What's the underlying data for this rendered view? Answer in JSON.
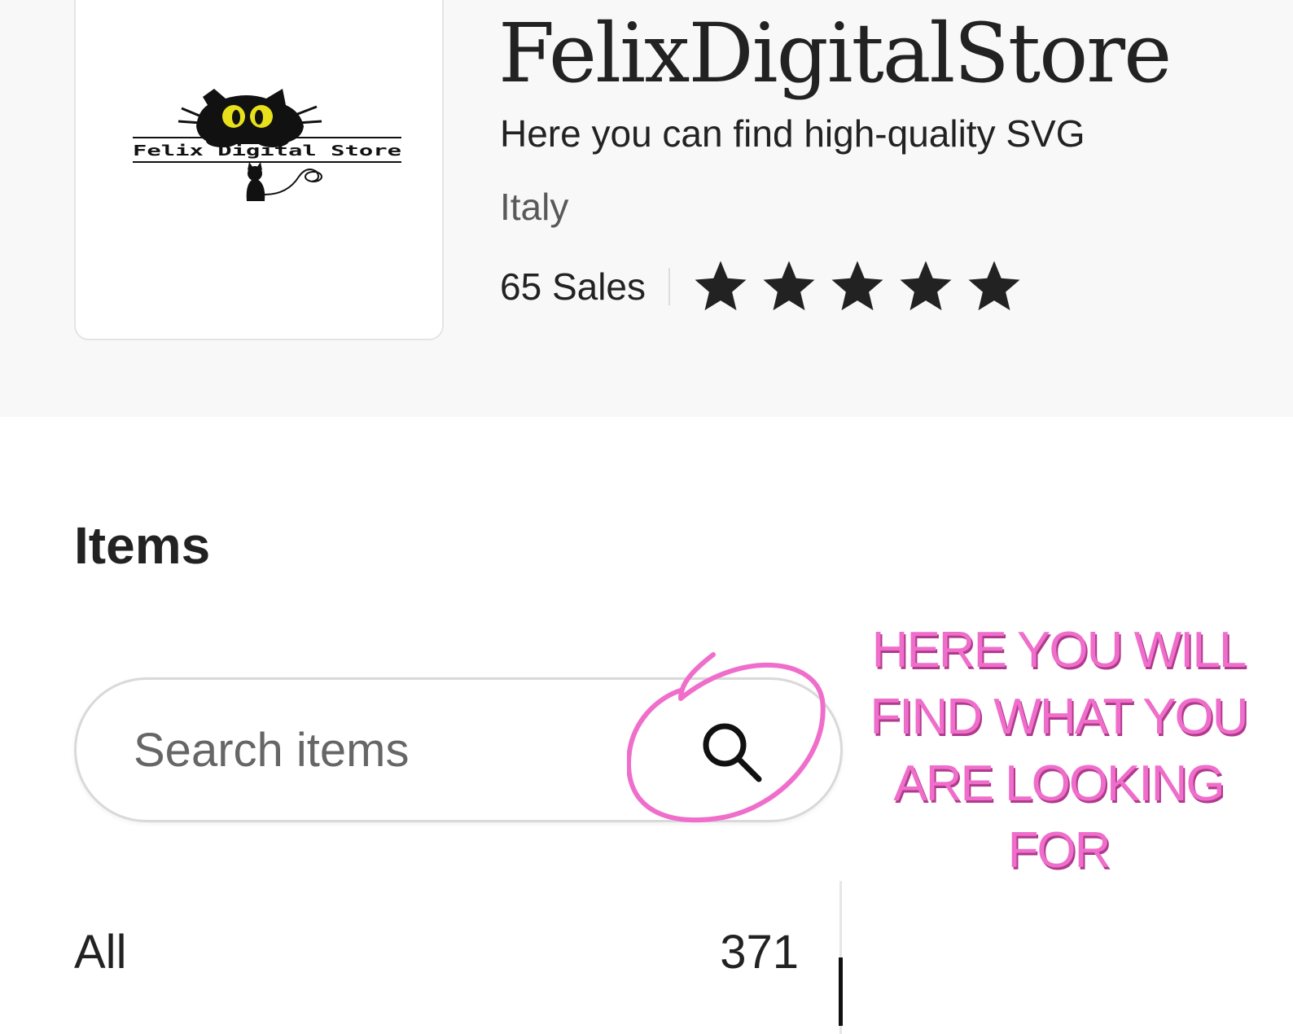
{
  "shop": {
    "name": "FelixDigitalStore",
    "tagline": "Here you can find high-quality SVG",
    "location": "Italy",
    "sales": "65 Sales",
    "rating": {
      "value": 5,
      "max": 5
    },
    "logo": {
      "text": "Felix Digital Store",
      "icon": "black-cat-logo"
    }
  },
  "items": {
    "heading": "Items",
    "search": {
      "placeholder": "Search items",
      "value": "",
      "icon": "search-icon"
    },
    "categories": [
      {
        "label": "All",
        "count": "371"
      }
    ]
  },
  "annotation": {
    "text": "HERE YOU WILL FIND WHAT YOU ARE LOOKING FOR",
    "color": "#f06ecb"
  },
  "colors": {
    "header_bg": "#f8f8f8",
    "text": "#222222",
    "muted": "#595959",
    "star": "#222222"
  }
}
